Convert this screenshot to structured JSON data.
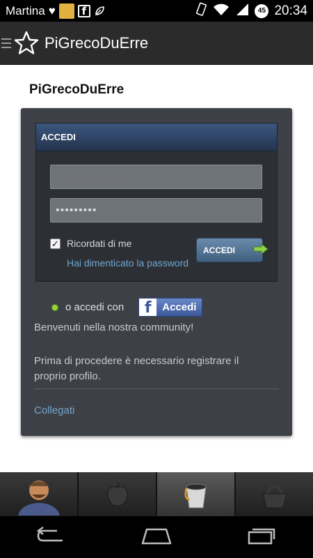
{
  "status_bar": {
    "carrier": "Martina",
    "heart": "♥",
    "fb_glyph": "f",
    "battery_level": "45",
    "time": "20:34",
    "icons": [
      "heart-icon",
      "avatar-notification-icon",
      "facebook-notification-icon",
      "leaf-icon",
      "vibrate-icon",
      "wifi-icon",
      "signal-icon",
      "battery-icon"
    ]
  },
  "app_bar": {
    "title": "PiGrecoDuErre",
    "icons": [
      "drawer-icon",
      "star-logo-icon"
    ]
  },
  "page": {
    "heading": "PiGrecoDuErre"
  },
  "login": {
    "header": "ACCEDI",
    "username_placeholder": "Username/Email",
    "password_value": "•••••••••",
    "remember_label": "Ricordati di me",
    "remember_checked": true,
    "check_mark": "✓",
    "forgot_link": "Hai dimenticato la password",
    "submit_label": "ACCEDI"
  },
  "social": {
    "label": "o accedi con",
    "facebook_glyph": "f",
    "facebook_label": "Accedi"
  },
  "welcome_text": "Benvenuti nella nostra community!",
  "intro_text": "Prima di procedere è necessario registrare il proprio profilo.",
  "collegati_link": "Collegati",
  "tab_bar": {
    "tabs": [
      {
        "icon": "farmer-avatar-icon",
        "active": false
      },
      {
        "icon": "apple-icon",
        "active": false
      },
      {
        "icon": "bucket-icon",
        "active": true
      },
      {
        "icon": "basket-icon",
        "active": false
      }
    ]
  },
  "nav_bar": {
    "icons": [
      "back-icon",
      "home-icon",
      "recent-apps-icon"
    ]
  },
  "colors": {
    "panel_bg": "#3d4147",
    "login_header": "#2f4566",
    "link": "#6fa6d0",
    "facebook": "#3b5998",
    "status_bar": "#000000",
    "app_bar": "#2b2b2b"
  }
}
